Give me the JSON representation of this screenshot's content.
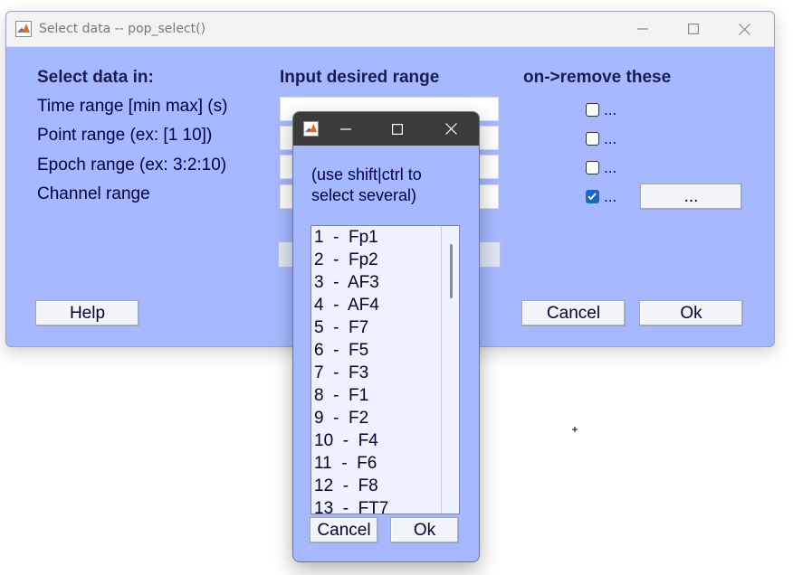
{
  "main_window": {
    "title": "Select data -- pop_select()",
    "headers": {
      "col1": "Select data in:",
      "col2": "Input desired range",
      "col3": "on->remove these"
    },
    "rows": [
      {
        "label": "Time range [min max] (s)",
        "checked": false,
        "ellipsis": "..."
      },
      {
        "label": "Point range (ex: [1 10])",
        "checked": false,
        "ellipsis": "..."
      },
      {
        "label": "Epoch range (ex: 3:2:10)",
        "checked": false,
        "ellipsis": "..."
      },
      {
        "label": "Channel range",
        "checked": true,
        "ellipsis": "..."
      }
    ],
    "channel_browse_label": "...",
    "help_label": "Help",
    "cancel_label": "Cancel",
    "ok_label": "Ok"
  },
  "channel_dialog": {
    "instructions_line1": "(use shift|ctrl to",
    "instructions_line2": "select several)",
    "channels": [
      "1  -  Fp1",
      "2  -  Fp2",
      "3  -  AF3",
      "4  -  AF4",
      "5  -  F7",
      "6  -  F5",
      "7  -  F3",
      "8  -  F1",
      "9  -  F2",
      "10  -  F4",
      "11  -  F6",
      "12  -  F8",
      "13  -  FT7"
    ],
    "cancel_label": "Cancel",
    "ok_label": "Ok"
  },
  "icons": {
    "app": "matlab-icon",
    "minimize": "minimize-icon",
    "maximize": "maximize-icon",
    "close": "close-icon"
  },
  "colors": {
    "window_bg": "#a6b8ff",
    "dialog_titlebar": "#3b3b3b",
    "checkbox_checked": "#1a67c2"
  }
}
